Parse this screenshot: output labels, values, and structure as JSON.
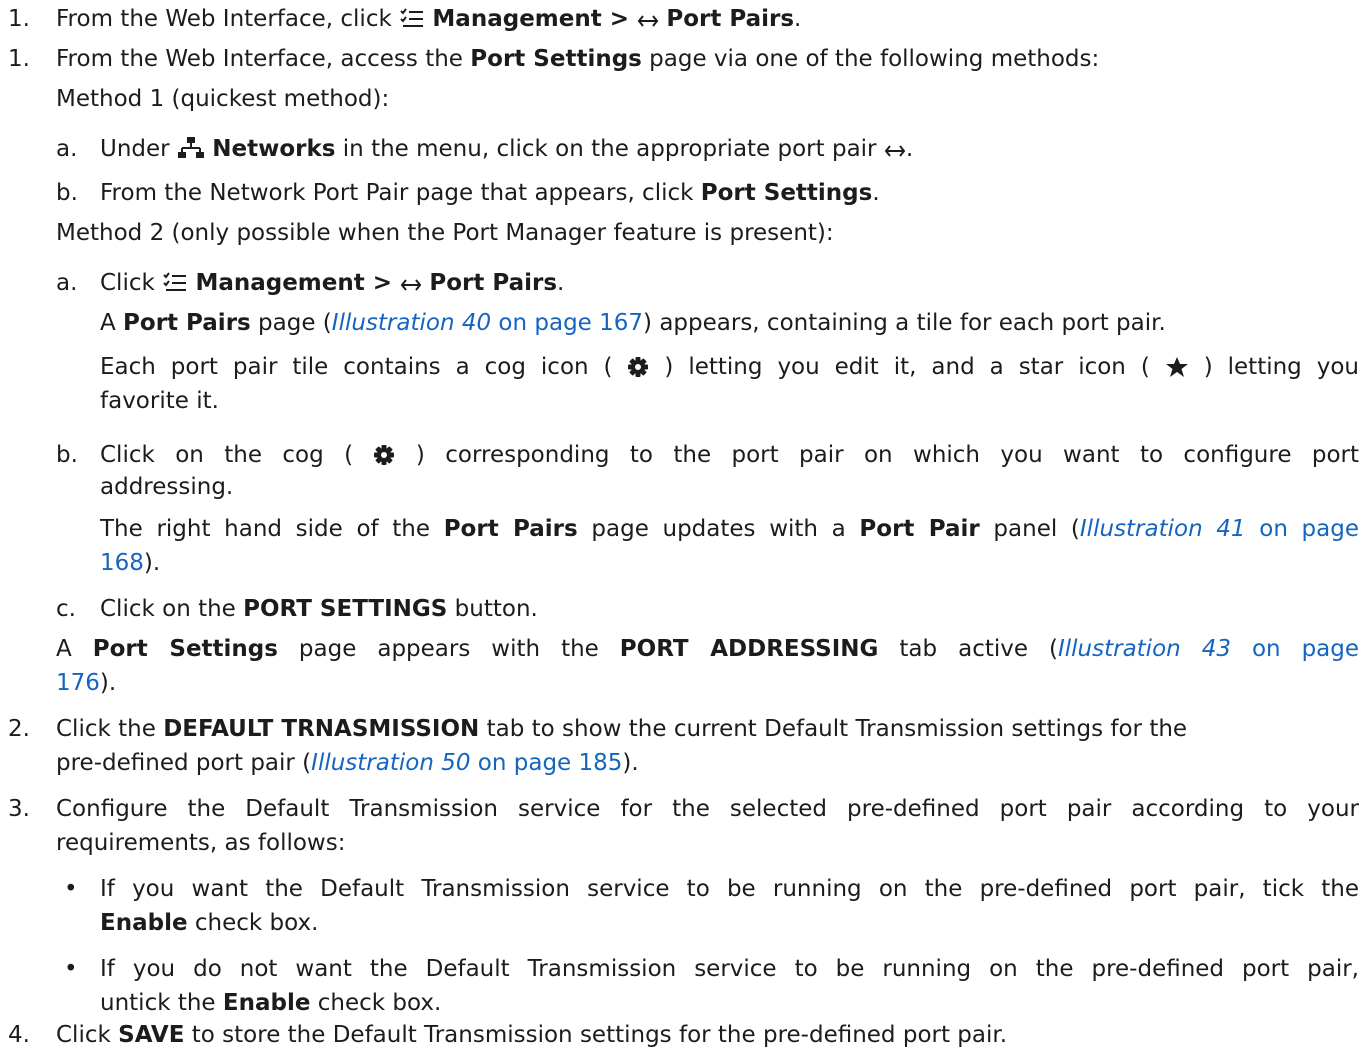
{
  "step1_top": {
    "num": "1.",
    "pre": "From the Web Interface, click ",
    "menu": "Management",
    "sep": " > ",
    "item": "Port Pairs",
    "end": "."
  },
  "step1": {
    "num": "1.",
    "pre": "From the Web Interface, access the ",
    "page": "Port Settings",
    "post": " page via one of the following methods:",
    "method1": "Method 1 (quickest method):",
    "m1a": {
      "letter": "a.",
      "pre": "Under ",
      "bold": "Networks",
      "post": " in the menu, click on the appropriate port pair ",
      "end": "."
    },
    "m1b": {
      "letter": "b.",
      "pre": "From the Network Port Pair page that appears, click ",
      "bold": "Port Settings",
      "end": "."
    },
    "method2": "Method 2 (only possible when the Port Manager feature is present):",
    "m2a": {
      "letter": "a.",
      "pre": "Click ",
      "menu": "Management",
      "sep": " > ",
      "item": "Port Pairs",
      "end": ".",
      "l2_pre": "A ",
      "l2_bold": "Port Pairs",
      "l2_mid": " page (",
      "l2_ill": "Illustration 40",
      "l2_ref": " on page 167",
      "l2_post": ") appears, containing a tile for each port pair.",
      "l3_a": "Each port pair tile contains a cog icon ( ",
      "l3_b": " ) letting you edit it, and a star icon ( ",
      "l3_c": ") letting you",
      "l4": "favorite it."
    },
    "m2b": {
      "letter": "b.",
      "l1_a": "Click on the cog ( ",
      "l1_b": " ) corresponding to the port pair on which you want to configure port",
      "l2": "addressing.",
      "l3_a": "The right hand side of the ",
      "l3_b": "Port Pairs",
      "l3_c": " page updates with a ",
      "l3_d": "Port Pair",
      "l3_e": " panel (",
      "l3_ill": "Illustration 41",
      "l3_ref": " on page",
      "l4_ref": "168",
      "l4_end": ")."
    },
    "m2c": {
      "letter": "c.",
      "pre": "Click on the ",
      "bold": "PORT SETTINGS",
      "post": " button."
    },
    "result": {
      "a": "A ",
      "b": "Port Settings",
      "c": " page appears with the ",
      "d": "PORT ADDRESSING",
      "e": " tab active (",
      "ill": "Illustration 43",
      "ref": " on page",
      "l2_ref": "176",
      "l2_end": ")."
    }
  },
  "step2": {
    "num": "2.",
    "a": "Click the ",
    "b": "DEFAULT TRNASMISSION",
    "c": " tab to show the current Default Transmission settings for the",
    "l2_a": "pre-defined port pair (",
    "l2_ill": "Illustration 50",
    "l2_ref": " on page 185",
    "l2_end": ")."
  },
  "step3": {
    "num": "3.",
    "l1": "Configure the Default Transmission service for the selected pre-defined port pair according to your",
    "l2": "requirements, as follows:",
    "b1_l1": "If you want the Default Transmission service to be running on the pre-defined port pair, tick the",
    "b1_bold": "Enable",
    "b1_end": " check box.",
    "b2_l1": "If you do not want the Default Transmission service to be running on the pre-defined port pair,",
    "b2_pre": "untick the ",
    "b2_bold": "Enable",
    "b2_end": " check box.",
    "bullet": "•"
  },
  "step4": {
    "num": "4.",
    "pre": "Click ",
    "bold": "SAVE",
    "post": " to store the Default Transmission settings for the pre-defined port pair."
  },
  "icons": {
    "management": "menu-checklist-icon",
    "port_pairs": "left-right-arrow-icon",
    "networks": "network-tree-icon",
    "cog": "cog-icon",
    "star": "star-icon",
    "link_color": "#1565c0"
  }
}
